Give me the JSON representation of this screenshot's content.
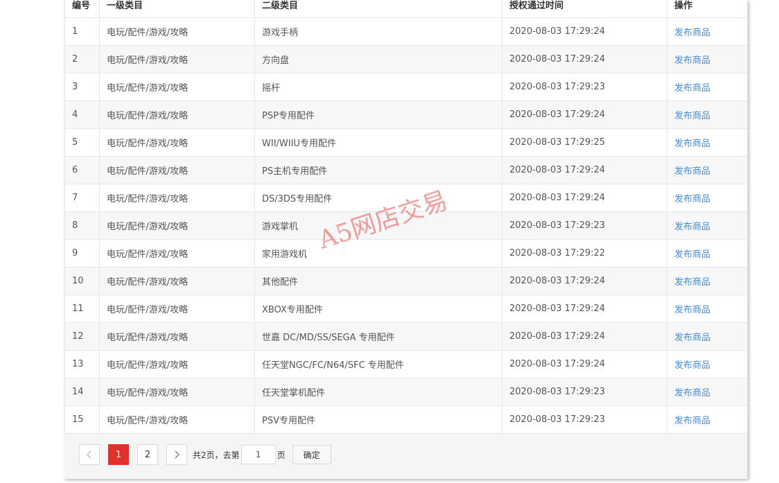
{
  "table": {
    "headers": [
      "编号",
      "一级类目",
      "二级类目",
      "授权通过时间",
      "操作"
    ],
    "rows": [
      {
        "id": "1",
        "cat1": "电玩/配件/游戏/攻略",
        "cat2": "游戏手柄",
        "time": "2020-08-03 17:29:24",
        "action": "发布商品"
      },
      {
        "id": "2",
        "cat1": "电玩/配件/游戏/攻略",
        "cat2": "方向盘",
        "time": "2020-08-03 17:29:24",
        "action": "发布商品"
      },
      {
        "id": "3",
        "cat1": "电玩/配件/游戏/攻略",
        "cat2": "摇杆",
        "time": "2020-08-03 17:29:23",
        "action": "发布商品"
      },
      {
        "id": "4",
        "cat1": "电玩/配件/游戏/攻略",
        "cat2": "PSP专用配件",
        "time": "2020-08-03 17:29:24",
        "action": "发布商品"
      },
      {
        "id": "5",
        "cat1": "电玩/配件/游戏/攻略",
        "cat2": "WII/WIIU专用配件",
        "time": "2020-08-03 17:29:25",
        "action": "发布商品"
      },
      {
        "id": "6",
        "cat1": "电玩/配件/游戏/攻略",
        "cat2": "PS主机专用配件",
        "time": "2020-08-03 17:29:24",
        "action": "发布商品"
      },
      {
        "id": "7",
        "cat1": "电玩/配件/游戏/攻略",
        "cat2": "DS/3DS专用配件",
        "time": "2020-08-03 17:29:24",
        "action": "发布商品"
      },
      {
        "id": "8",
        "cat1": "电玩/配件/游戏/攻略",
        "cat2": "游戏掌机",
        "time": "2020-08-03 17:29:23",
        "action": "发布商品"
      },
      {
        "id": "9",
        "cat1": "电玩/配件/游戏/攻略",
        "cat2": "家用游戏机",
        "time": "2020-08-03 17:29:22",
        "action": "发布商品"
      },
      {
        "id": "10",
        "cat1": "电玩/配件/游戏/攻略",
        "cat2": "其他配件",
        "time": "2020-08-03 17:29:24",
        "action": "发布商品"
      },
      {
        "id": "11",
        "cat1": "电玩/配件/游戏/攻略",
        "cat2": "XBOX专用配件",
        "time": "2020-08-03 17:29:24",
        "action": "发布商品"
      },
      {
        "id": "12",
        "cat1": "电玩/配件/游戏/攻略",
        "cat2": "世嘉 DC/MD/SS/SEGA 专用配件",
        "time": "2020-08-03 17:29:24",
        "action": "发布商品"
      },
      {
        "id": "13",
        "cat1": "电玩/配件/游戏/攻略",
        "cat2": "任天堂NGC/FC/N64/SFC 专用配件",
        "time": "2020-08-03 17:29:24",
        "action": "发布商品"
      },
      {
        "id": "14",
        "cat1": "电玩/配件/游戏/攻略",
        "cat2": "任天堂掌机配件",
        "time": "2020-08-03 17:29:23",
        "action": "发布商品"
      },
      {
        "id": "15",
        "cat1": "电玩/配件/游戏/攻略",
        "cat2": "PSV专用配件",
        "time": "2020-08-03 17:29:23",
        "action": "发布商品"
      }
    ]
  },
  "pagination": {
    "prev_icon": "chevron-left-icon",
    "next_icon": "chevron-right-icon",
    "pages": [
      "1",
      "2"
    ],
    "current_page": "1",
    "total_text": "共2页，去第",
    "input_value": "1",
    "page_suffix": "页",
    "confirm_label": "确定",
    "active_color": "#e3302d"
  },
  "watermark": {
    "text": "A5网店交易"
  },
  "colors": {
    "link": "#3a8ee6",
    "active_page": "#e3302d"
  }
}
